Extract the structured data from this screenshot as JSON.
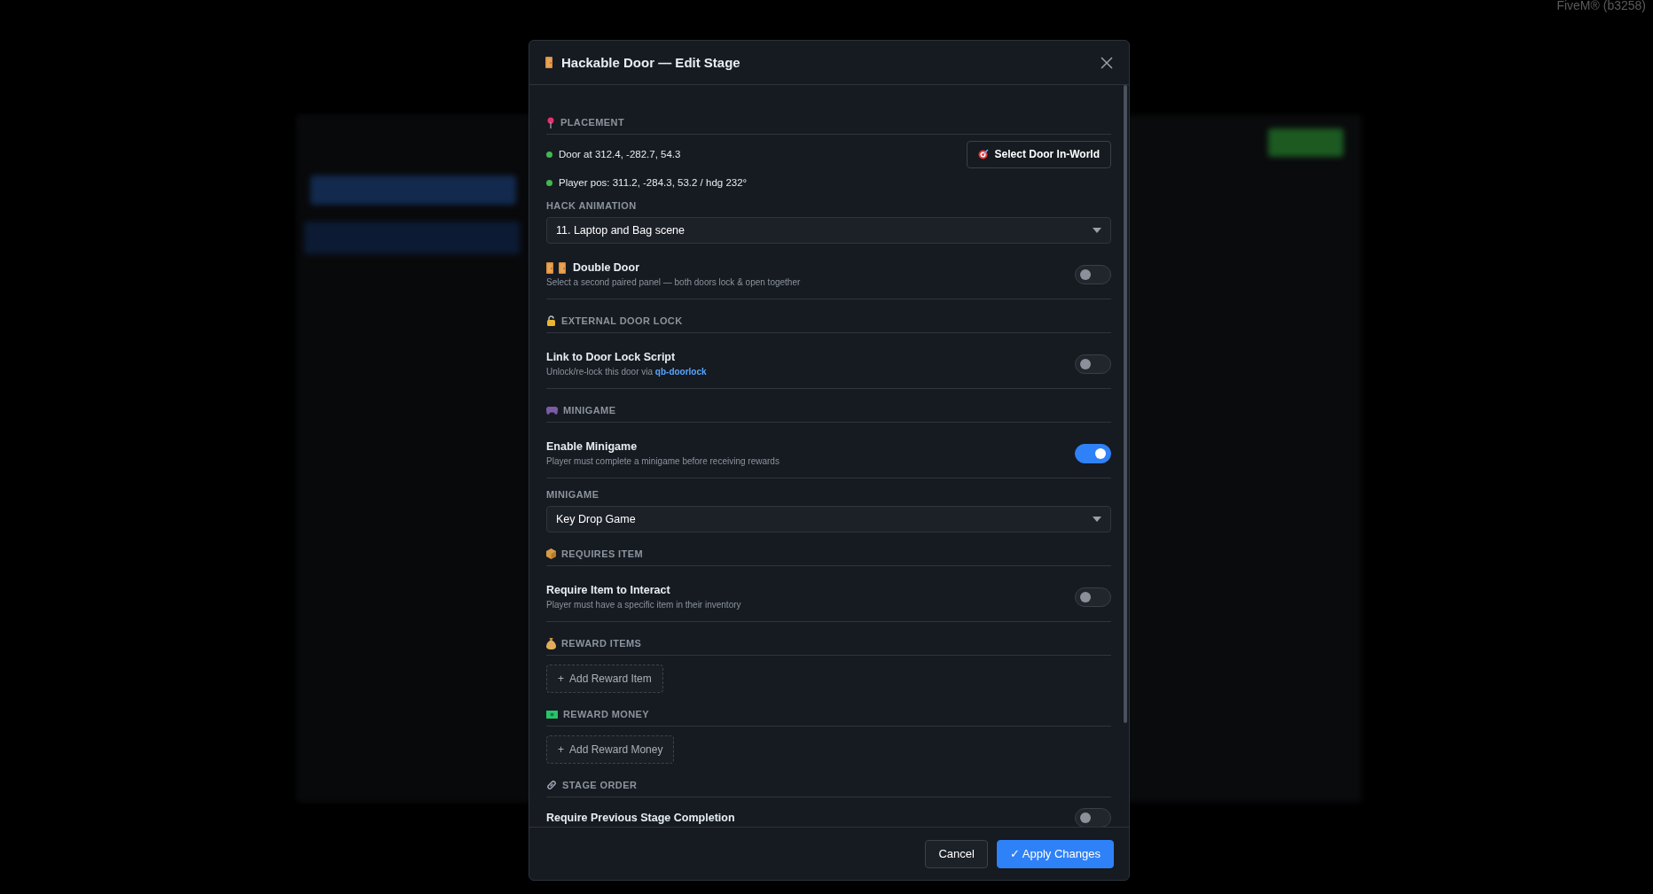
{
  "corner_text": "FiveM® (b3258)",
  "dialog": {
    "title": "Hackable Door — Edit Stage",
    "blocks": [
      {
        "kind": "heading",
        "text": "PLACEMENT"
      },
      {
        "kind": "status",
        "text": "Door at 312.4, -282.7, 54.3",
        "color": "#3fb950",
        "button": "Select Door In-World"
      },
      {
        "kind": "status",
        "text": "Player pos: 311.2, -284.3, 53.2 / hdg 232°",
        "color": "#3fb950"
      },
      {
        "kind": "label",
        "text": "HACK ANIMATION"
      },
      {
        "kind": "select",
        "value": "11. Laptop and Bag scene"
      },
      {
        "kind": "door-toggle",
        "title": "Double Door",
        "description": "Select a second paired panel — both doors lock & open together",
        "on": false
      },
      {
        "kind": "heading",
        "text": "EXTERNAL DOOR LOCK"
      },
      {
        "kind": "toggle",
        "title": "Link to Door Lock Script",
        "description": "Unlock/re-lock this door via",
        "link": "qb-doorlock",
        "on": false
      },
      {
        "kind": "heading",
        "text": "MINIGAME"
      },
      {
        "kind": "toggle",
        "title": "Enable Minigame",
        "description": "Player must complete a minigame before receiving rewards",
        "on": true
      },
      {
        "kind": "label",
        "text": "MINIGAME"
      },
      {
        "kind": "select",
        "value": "Key Drop Game"
      },
      {
        "kind": "heading",
        "text": "REQUIRES ITEM"
      },
      {
        "kind": "toggle",
        "title": "Require Item to Interact",
        "description": "Player must have a specific item in their inventory",
        "on": false
      },
      {
        "kind": "heading",
        "text": "REWARD ITEMS"
      },
      {
        "kind": "add",
        "text": "+  Add Reward Item"
      },
      {
        "kind": "heading",
        "text": "REWARD MONEY"
      },
      {
        "kind": "add",
        "text": "+  Add Reward Money"
      },
      {
        "kind": "heading",
        "text": "STAGE ORDER"
      },
      {
        "kind": "toggle",
        "title": "Require Previous Stage Completion",
        "on": false
      }
    ],
    "buttons": [
      {
        "kind": "secondary",
        "text": "Cancel"
      },
      {
        "kind": "primary",
        "text": "✓ Apply Changes"
      }
    ]
  }
}
